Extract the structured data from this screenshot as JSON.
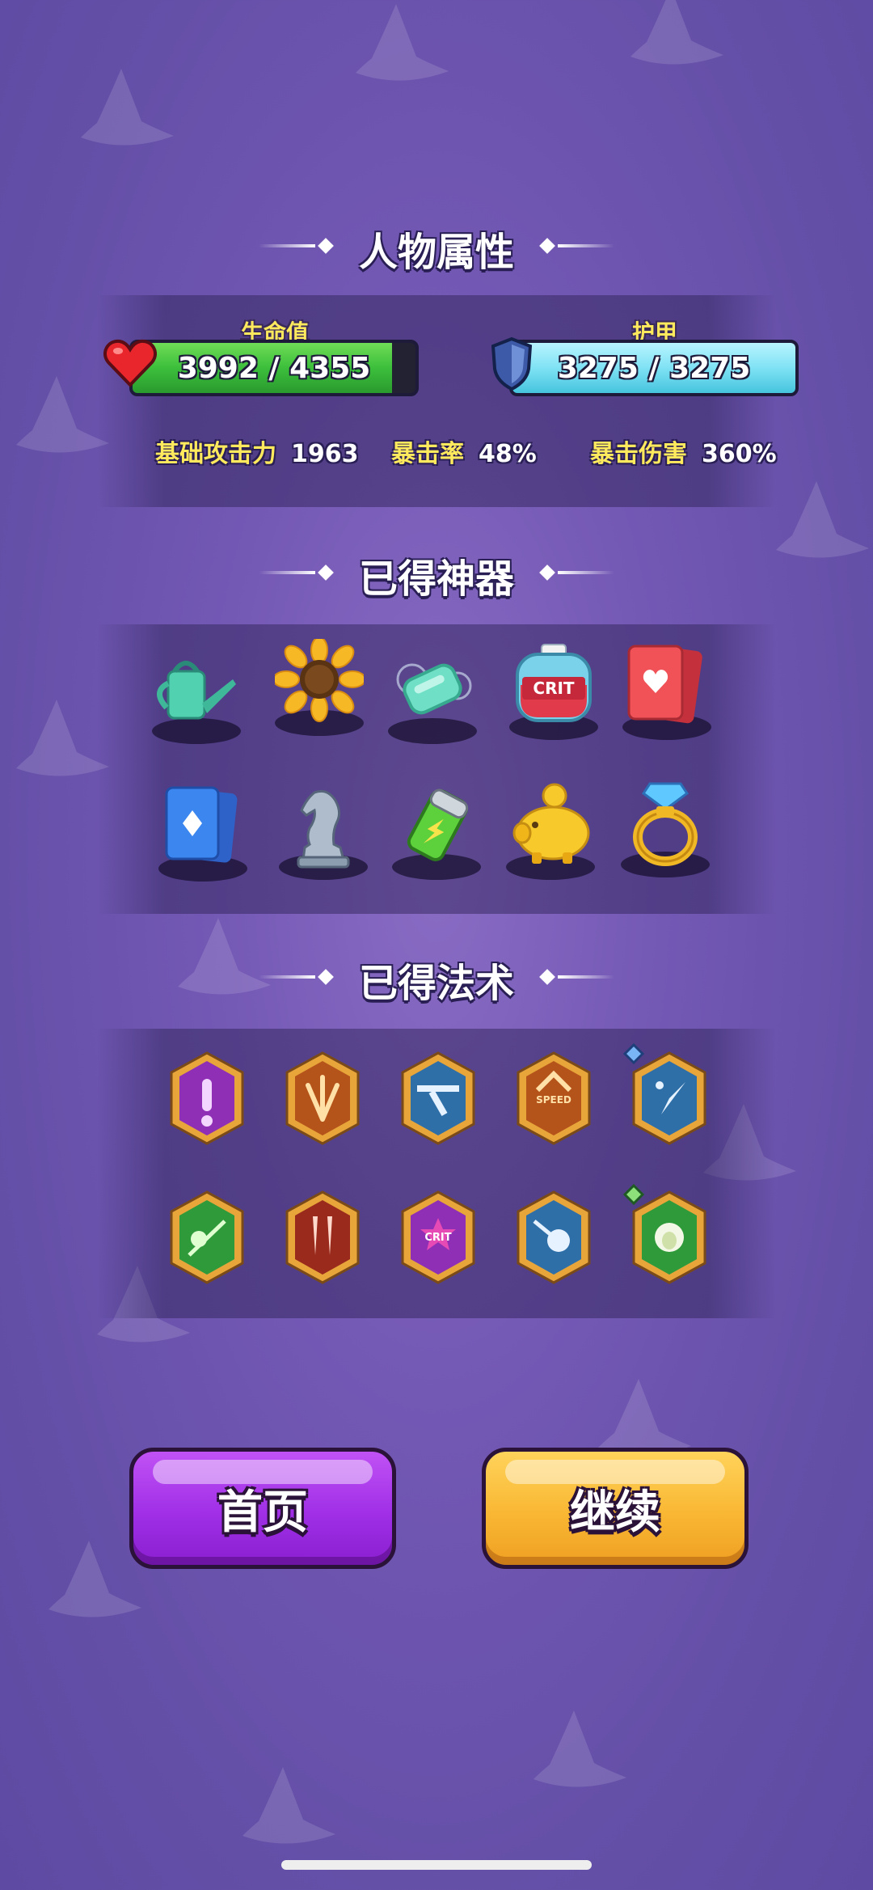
{
  "sections": {
    "attributes_title": "人物属性",
    "artifacts_title": "已得神器",
    "spells_title": "已得法术"
  },
  "hp": {
    "label": "生命值",
    "value": "3992 / 4355",
    "fill_ratio": 0.917,
    "color": "#3cbf3c"
  },
  "armor": {
    "label": "护甲",
    "value": "3275 / 3275",
    "fill_ratio": 1.0,
    "color": "#7fe2f4"
  },
  "stats": [
    {
      "label": "基础攻击力",
      "value": "1963"
    },
    {
      "label": "暴击率",
      "value": "48%"
    },
    {
      "label": "暴击伤害",
      "value": "360%"
    }
  ],
  "artifacts": [
    "watering-can-icon",
    "sunflower-icon",
    "soap-icon",
    "crit-potion-icon",
    "heart-card-icon",
    "diamond-card-icon",
    "chess-knight-icon",
    "battery-icon",
    "piggy-bank-icon",
    "diamond-ring-icon"
  ],
  "artifact_crit_label": "CRIT",
  "spells": [
    "exclamation-spell-icon",
    "burst-spell-icon",
    "launcher-spell-icon",
    "speed-spell-icon",
    "crystal-spell-icon",
    "poison-spell-icon",
    "twin-fang-spell-icon",
    "crit-spell-icon",
    "orb-spell-icon",
    "sheep-spell-icon"
  ],
  "spell_labels": {
    "speed": "SPEED",
    "crit": "CRIT"
  },
  "buttons": {
    "home": "首页",
    "continue": "继续"
  },
  "colors": {
    "background": "#6e56b1",
    "title_text": "#ffffff",
    "stat_key": "#ffe95c",
    "home_button": "#a02fe6",
    "continue_button": "#f9b733"
  }
}
